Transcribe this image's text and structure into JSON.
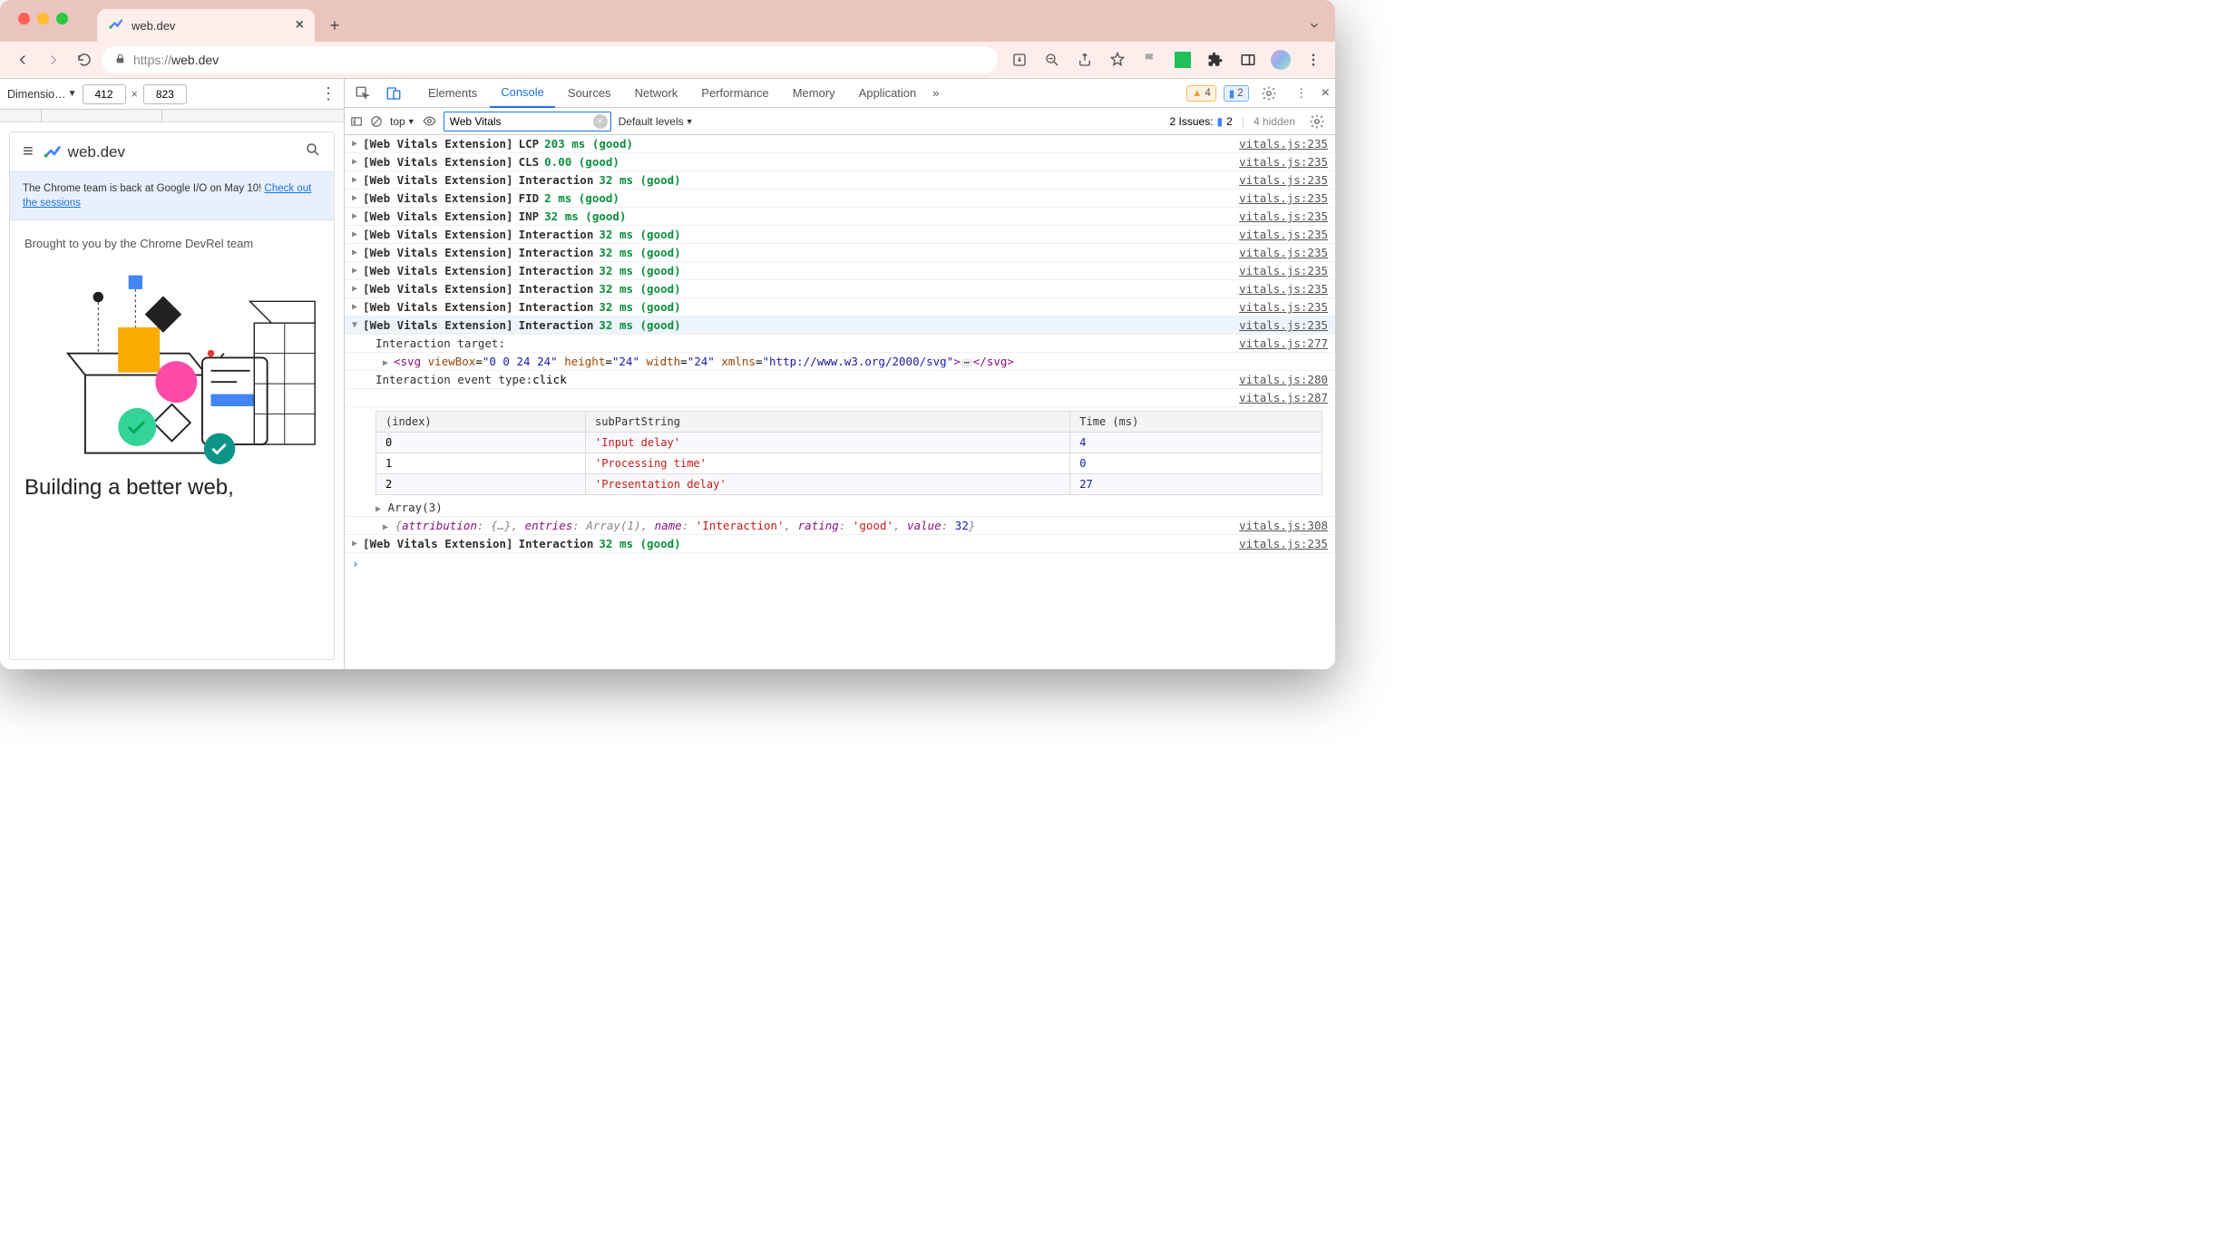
{
  "browser": {
    "tab_title": "web.dev",
    "url": "https://web.dev",
    "url_display_grey": "https://",
    "url_display_main": "web.dev"
  },
  "device_toolbar": {
    "label": "Dimensio…",
    "width": "412",
    "height": "823"
  },
  "page": {
    "site_name": "web.dev",
    "banner_pre": "The Chrome team is back at Google I/O on May 10! ",
    "banner_link": "Check out the sessions",
    "brought": "Brought to you by the Chrome DevRel team",
    "hero_title": "Building a better web,"
  },
  "devtools": {
    "tabs": [
      "Elements",
      "Console",
      "Sources",
      "Network",
      "Performance",
      "Memory",
      "Application"
    ],
    "active_tab": "Console",
    "warn_badge": "4",
    "msg_badge": "2",
    "context": "top",
    "filter_value": "Web Vitals",
    "levels_label": "Default levels",
    "issues_label": "2 Issues:",
    "issues_count": "2",
    "hidden_label": "4 hidden"
  },
  "logs": [
    {
      "prefix": "[Web Vitals Extension]",
      "metric": "LCP",
      "value": "203 ms (good)",
      "src": "vitals.js:235"
    },
    {
      "prefix": "[Web Vitals Extension]",
      "metric": "CLS",
      "value": "0.00 (good)",
      "src": "vitals.js:235"
    },
    {
      "prefix": "[Web Vitals Extension]",
      "metric": "Interaction",
      "value": "32 ms (good)",
      "src": "vitals.js:235"
    },
    {
      "prefix": "[Web Vitals Extension]",
      "metric": "FID",
      "value": "2 ms (good)",
      "src": "vitals.js:235"
    },
    {
      "prefix": "[Web Vitals Extension]",
      "metric": "INP",
      "value": "32 ms (good)",
      "src": "vitals.js:235"
    },
    {
      "prefix": "[Web Vitals Extension]",
      "metric": "Interaction",
      "value": "32 ms (good)",
      "src": "vitals.js:235"
    },
    {
      "prefix": "[Web Vitals Extension]",
      "metric": "Interaction",
      "value": "32 ms (good)",
      "src": "vitals.js:235"
    },
    {
      "prefix": "[Web Vitals Extension]",
      "metric": "Interaction",
      "value": "32 ms (good)",
      "src": "vitals.js:235"
    },
    {
      "prefix": "[Web Vitals Extension]",
      "metric": "Interaction",
      "value": "32 ms (good)",
      "src": "vitals.js:235"
    },
    {
      "prefix": "[Web Vitals Extension]",
      "metric": "Interaction",
      "value": "32 ms (good)",
      "src": "vitals.js:235"
    }
  ],
  "expanded_log": {
    "prefix": "[Web Vitals Extension]",
    "metric": "Interaction",
    "value": "32 ms (good)",
    "src": "vitals.js:235",
    "target_label": "Interaction target:",
    "target_src": "vitals.js:277",
    "svg_text": "<svg viewBox=\"0 0 24 24\" height=\"24\" width=\"24\" xmlns=\"http://www.w3.org/2000/svg\">…</svg>",
    "event_label": "Interaction event type: ",
    "event_val": "click",
    "event_src": "vitals.js:280",
    "table_src": "vitals.js:287",
    "table_headers": [
      "(index)",
      "subPartString",
      "Time (ms)"
    ],
    "table_rows": [
      {
        "i": "0",
        "s": "'Input delay'",
        "t": "4"
      },
      {
        "i": "1",
        "s": "'Processing time'",
        "t": "0"
      },
      {
        "i": "2",
        "s": "'Presentation delay'",
        "t": "27"
      }
    ],
    "array_label": "Array(3)",
    "obj_text": "{attribution: {…}, entries: Array(1), name: 'Interaction', rating: 'good', value: 32}",
    "obj_src": "vitals.js:308"
  },
  "trailing_log": {
    "prefix": "[Web Vitals Extension]",
    "metric": "Interaction",
    "value": "32 ms (good)",
    "src": "vitals.js:235"
  }
}
